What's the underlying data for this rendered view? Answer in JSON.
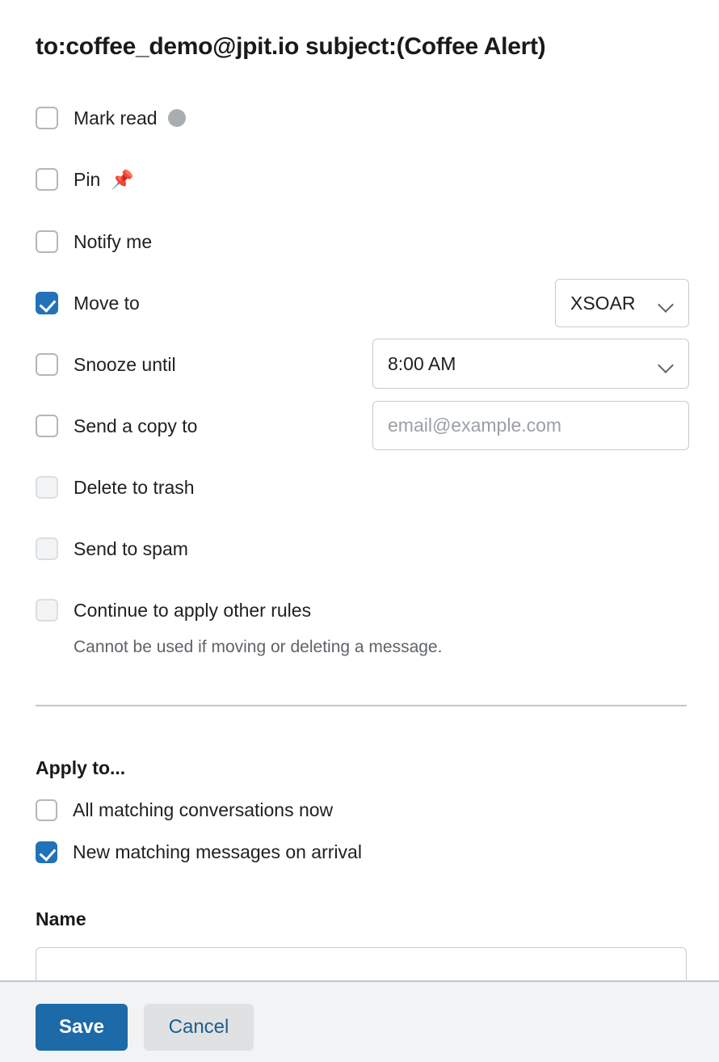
{
  "dialog": {
    "title": "to:coffee_demo@jpit.io subject:(Coffee Alert)"
  },
  "actions": [
    {
      "label": "Mark read",
      "checked": false,
      "disabled": false,
      "icon": "gray-dot-icon"
    },
    {
      "label": "Pin",
      "checked": false,
      "disabled": false,
      "icon": "pushpin-icon"
    },
    {
      "label": "Notify me",
      "checked": false,
      "disabled": false,
      "icon": ""
    },
    {
      "label": "Move to",
      "checked": true,
      "disabled": false,
      "icon": ""
    },
    {
      "label": "Snooze until",
      "checked": false,
      "disabled": false,
      "icon": ""
    },
    {
      "label": "Send a copy to",
      "checked": false,
      "disabled": false,
      "icon": ""
    },
    {
      "label": "Delete to trash",
      "checked": false,
      "disabled": true,
      "icon": ""
    },
    {
      "label": "Send to spam",
      "checked": false,
      "disabled": true,
      "icon": ""
    },
    {
      "label": "Continue to apply other rules",
      "checked": false,
      "disabled": true,
      "icon": ""
    }
  ],
  "helper": {
    "continue_rules": "Cannot be used if moving or deleting a message."
  },
  "controls": {
    "move_to": {
      "value": "XSOAR",
      "icon": "chevron-down-icon"
    },
    "snooze_until": {
      "value": "8:00 AM",
      "icon": "chevron-down-icon"
    },
    "send_copy_to": {
      "value": "",
      "placeholder": "email@example.com"
    }
  },
  "apply_to": {
    "heading": "Apply to...",
    "options": [
      {
        "label": "All matching conversations now",
        "checked": false
      },
      {
        "label": "New matching messages on arrival",
        "checked": true
      }
    ]
  },
  "name_field": {
    "label": "Name",
    "value": "",
    "placeholder": ""
  },
  "footer": {
    "save_label": "Save",
    "cancel_label": "Cancel"
  },
  "colors": {
    "accent_blue": "#2272ba",
    "save_blue": "#1c6aa8",
    "cancel_text_blue": "#1b5e8e",
    "cancel_bg": "#dfe1e3",
    "pin_red": "#c0182c",
    "dot_gray": "#a9adaf",
    "footer_bg": "#f2f3f4"
  }
}
